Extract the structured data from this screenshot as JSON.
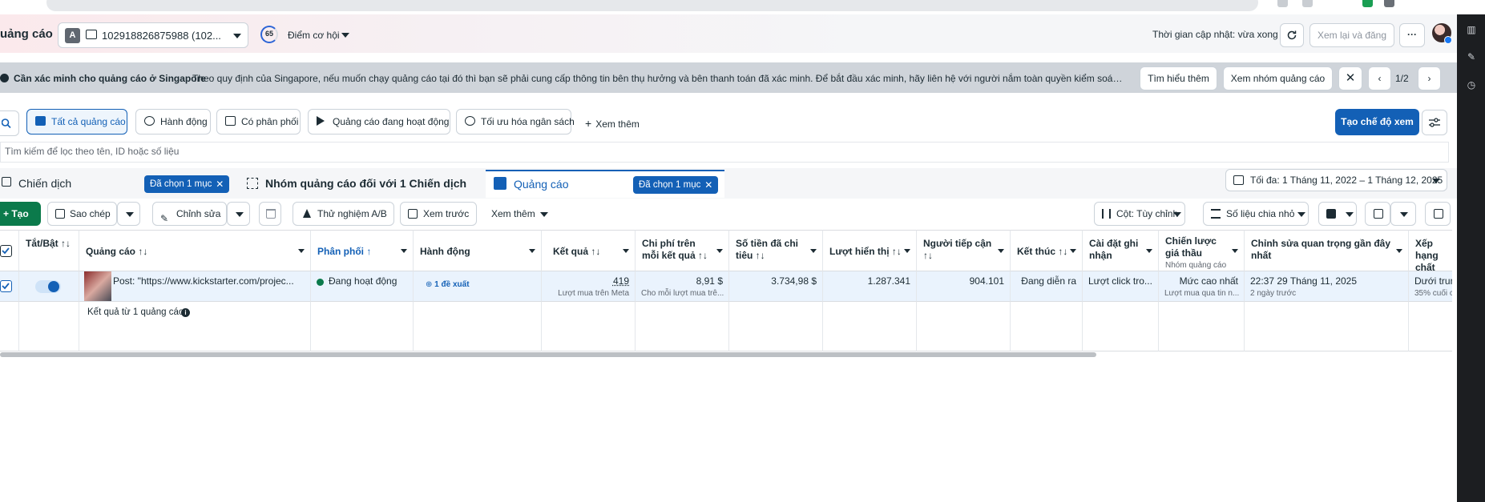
{
  "header": {
    "title": "uảng cáo",
    "account_badge": "A",
    "account_name": "102918826875988 (102...",
    "score": "65",
    "opportunity_label": "Điểm cơ hội",
    "updated_text": "Thời gian cập nhật: vừa xong",
    "review_publish_label": "Xem lại và đăng",
    "more_label": "···"
  },
  "banner": {
    "title": "Cần xác minh cho quảng cáo ở Singapore",
    "text": "Theo quy định của Singapore, nếu muốn chạy quảng cáo tại đó thì bạn sẽ phải cung cấp thông tin bên thụ hưởng và bên thanh toán đã xác minh. Để bắt đầu xác minh, hãy liên hệ với người nắm toàn quyền kiểm soát tài khoản quản...",
    "learn_more": "Tìm hiểu thêm",
    "view_adsets": "Xem nhóm quảng cáo",
    "page": "1/2"
  },
  "filters": {
    "items": [
      "Tất cả quảng cáo",
      "Hành động",
      "Có phân phối",
      "Quảng cáo đang hoạt động",
      "Tối ưu hóa ngân sách"
    ],
    "more": "Xem thêm",
    "create_view": "Tạo chế độ xem"
  },
  "search": {
    "placeholder": "Tìm kiếm để lọc theo tên, ID hoặc số liệu"
  },
  "tabs": {
    "campaign": "Chiến dịch",
    "campaign_chip": "Đã chọn 1 mục",
    "adset": "Nhóm quảng cáo đối với 1 Chiến dịch",
    "ad": "Quảng cáo",
    "ad_chip": "Đã chọn 1 mục",
    "date_range": "Tối đa: 1 Tháng 11, 2022 – 1 Tháng 12, 2025"
  },
  "toolbar": {
    "create": "+ Tạo",
    "duplicate": "Sao chép",
    "edit": "Chỉnh sửa",
    "ab_test": "Thử nghiệm A/B",
    "preview": "Xem trước",
    "see_more": "Xem thêm",
    "columns": "Cột: Tùy chỉnh",
    "breakdown": "Số liệu chia nhỏ"
  },
  "table": {
    "headers": {
      "toggle": "Tắt/Bật ↑↓",
      "ad": "Quảng cáo ↑↓",
      "delivery": "Phân phối ↑",
      "actions": "Hành động",
      "results": "Kết quả ↑↓",
      "cpr": "Chi phí trên mỗi kết quả ↑↓",
      "spent": "Số tiền đã chi tiêu ↑↓",
      "impressions": "Lượt hiển thị ↑↓",
      "reach": "Người tiếp cận ↑↓",
      "ends": "Kết thúc ↑↓",
      "attribution": "Cài đặt ghi nhận",
      "bid": "Chiến lược giá thầu",
      "bid_sub": "Nhóm quảng cáo",
      "last_edit": "Chỉnh sửa quan trọng gần đây nhất",
      "quality": "Xếp hạng chất lượng"
    },
    "row": {
      "ad_name": "Post: \"https://www.kickstarter.com/projec...",
      "delivery": "Đang hoạt động",
      "actions": "1 đề xuất",
      "results": "419",
      "results_sub": "Lượt mua trên Meta",
      "cpr": "8,91 $",
      "cpr_sub": "Cho mỗi lượt mua trê...",
      "spent": "3.734,98 $",
      "impressions": "1.287.341",
      "reach": "904.101",
      "ends": "Đang diễn ra",
      "attribution": "Lượt click tro...",
      "bid": "Mức cao nhất",
      "bid_sub": "Lượt mua qua tin n...",
      "last_edit": "22:37 29 Tháng 11, 2025",
      "last_edit_sub": "2 ngày trước",
      "quality": "Dưới trun",
      "quality_sub": "35% cuối c"
    },
    "footer": "Kết quả từ 1 quảng cáo"
  },
  "colors": {
    "primary": "#1360b6",
    "create_green": "#0b7a4b",
    "active_green": "#0b7a4b",
    "row_selected": "#eaf3fd"
  }
}
